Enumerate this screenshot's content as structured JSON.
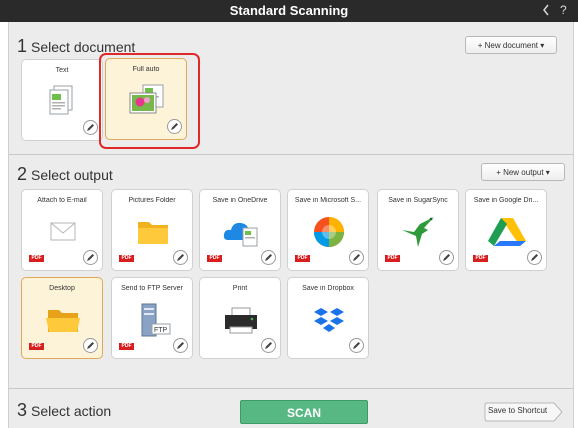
{
  "window": {
    "title": "Standard Scanning",
    "back_icon": "chevron-left-icon",
    "help_icon": "help-icon",
    "help_glyph": "?"
  },
  "document_section": {
    "number": "1",
    "title": "Select document",
    "new_button": "+ New document ▾",
    "items": [
      {
        "label": "Text",
        "icon": "text-document-icon",
        "selected": false
      },
      {
        "label": "Full auto",
        "icon": "photo-document-icon",
        "selected": true
      }
    ]
  },
  "output_section": {
    "number": "2",
    "title": "Select output",
    "new_button": "+ New output ▾",
    "items": [
      {
        "label": "Attach to E-mail",
        "icon": "email-icon",
        "badge": "PDF",
        "selected": false
      },
      {
        "label": "Pictures Folder",
        "icon": "folder-icon",
        "badge": "PDF",
        "selected": false
      },
      {
        "label": "Save in OneDrive",
        "icon": "onedrive-icon",
        "badge": "PDF",
        "selected": false
      },
      {
        "label": "Save in Microsoft S...",
        "icon": "sharepoint-icon",
        "badge": "PDF",
        "selected": false
      },
      {
        "label": "Save in SugarSync",
        "icon": "sugarsync-icon",
        "badge": "PDF",
        "selected": false
      },
      {
        "label": "Save in Google Dri...",
        "icon": "google-drive-icon",
        "badge": "PDF",
        "selected": false
      },
      {
        "label": "Desktop",
        "icon": "open-folder-icon",
        "badge": "PDF",
        "selected": true
      },
      {
        "label": "Send to FTP Server",
        "icon": "ftp-server-icon",
        "badge": "PDF",
        "selected": false
      },
      {
        "label": "Print",
        "icon": "printer-icon",
        "badge": "",
        "selected": false
      },
      {
        "label": "Save in Dropbox",
        "icon": "dropbox-icon",
        "badge": "",
        "selected": false
      }
    ]
  },
  "action_section": {
    "number": "3",
    "title": "Select action",
    "scan_button": "SCAN",
    "shortcut_button": "Save to Shortcut"
  },
  "colors": {
    "title_bar": "#2a2a2a",
    "panel_bg": "#ececec",
    "selected_card": "#fdf3d8",
    "highlight_border": "#e02a2a",
    "scan_button": "#58b884",
    "pdf_badge": "#d81e1e"
  }
}
